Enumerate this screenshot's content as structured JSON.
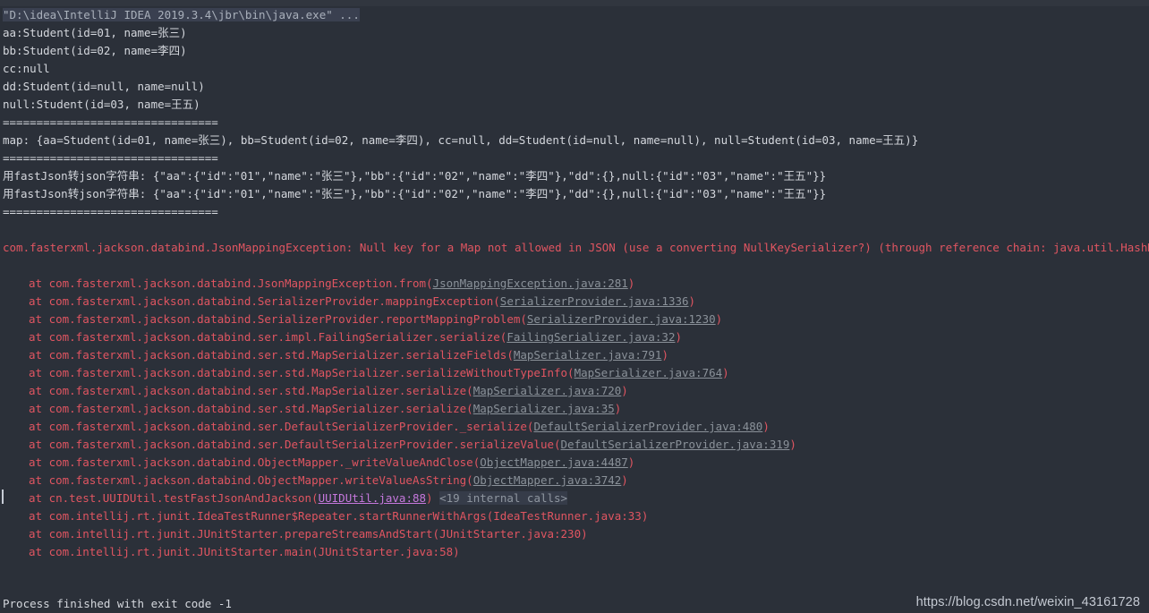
{
  "console": {
    "command_line": "\"D:\\idea\\IntelliJ IDEA 2019.3.4\\jbr\\bin\\java.exe\" ...",
    "output_lines": [
      "aa:Student(id=01, name=张三)",
      "bb:Student(id=02, name=李四)",
      "cc:null",
      "dd:Student(id=null, name=null)",
      "null:Student(id=03, name=王五)"
    ],
    "separator": "================================",
    "map_line": "map: {aa=Student(id=01, name=张三), bb=Student(id=02, name=李四), cc=null, dd=Student(id=null, name=null), null=Student(id=03, name=王五)}",
    "fastjson_line_1": "用fastJson转json字符串: {\"aa\":{\"id\":\"01\",\"name\":\"张三\"},\"bb\":{\"id\":\"02\",\"name\":\"李四\"},\"dd\":{},null:{\"id\":\"03\",\"name\":\"王五\"}}",
    "fastjson_line_2": "用fastJson转json字符串: {\"aa\":{\"id\":\"01\",\"name\":\"张三\"},\"bb\":{\"id\":\"02\",\"name\":\"李四\"},\"dd\":{},null:{\"id\":\"03\",\"name\":\"王五\"}}",
    "exception_header": "com.fasterxml.jackson.databind.JsonMappingException: Null key for a Map not allowed in JSON (use a converting NullKeySerializer?) (through reference chain: java.util.HashMap[\"null\"])",
    "stack_frames": [
      {
        "prefix": "at com.fasterxml.jackson.databind.JsonMappingException.from(",
        "link": "JsonMappingException.java:281",
        "link_style": "normal",
        "suffix": ")",
        "trailing": ""
      },
      {
        "prefix": "at com.fasterxml.jackson.databind.SerializerProvider.mappingException(",
        "link": "SerializerProvider.java:1336",
        "link_style": "normal",
        "suffix": ")",
        "trailing": ""
      },
      {
        "prefix": "at com.fasterxml.jackson.databind.SerializerProvider.reportMappingProblem(",
        "link": "SerializerProvider.java:1230",
        "link_style": "normal",
        "suffix": ")",
        "trailing": ""
      },
      {
        "prefix": "at com.fasterxml.jackson.databind.ser.impl.FailingSerializer.serialize(",
        "link": "FailingSerializer.java:32",
        "link_style": "normal",
        "suffix": ")",
        "trailing": ""
      },
      {
        "prefix": "at com.fasterxml.jackson.databind.ser.std.MapSerializer.serializeFields(",
        "link": "MapSerializer.java:791",
        "link_style": "normal",
        "suffix": ")",
        "trailing": ""
      },
      {
        "prefix": "at com.fasterxml.jackson.databind.ser.std.MapSerializer.serializeWithoutTypeInfo(",
        "link": "MapSerializer.java:764",
        "link_style": "normal",
        "suffix": ")",
        "trailing": ""
      },
      {
        "prefix": "at com.fasterxml.jackson.databind.ser.std.MapSerializer.serialize(",
        "link": "MapSerializer.java:720",
        "link_style": "normal",
        "suffix": ")",
        "trailing": ""
      },
      {
        "prefix": "at com.fasterxml.jackson.databind.ser.std.MapSerializer.serialize(",
        "link": "MapSerializer.java:35",
        "link_style": "normal",
        "suffix": ")",
        "trailing": ""
      },
      {
        "prefix": "at com.fasterxml.jackson.databind.ser.DefaultSerializerProvider._serialize(",
        "link": "DefaultSerializerProvider.java:480",
        "link_style": "normal",
        "suffix": ")",
        "trailing": ""
      },
      {
        "prefix": "at com.fasterxml.jackson.databind.ser.DefaultSerializerProvider.serializeValue(",
        "link": "DefaultSerializerProvider.java:319",
        "link_style": "normal",
        "suffix": ")",
        "trailing": ""
      },
      {
        "prefix": "at com.fasterxml.jackson.databind.ObjectMapper._writeValueAndClose(",
        "link": "ObjectMapper.java:4487",
        "link_style": "normal",
        "suffix": ")",
        "trailing": ""
      },
      {
        "prefix": "at com.fasterxml.jackson.databind.ObjectMapper.writeValueAsString(",
        "link": "ObjectMapper.java:3742",
        "link_style": "normal",
        "suffix": ")",
        "trailing": ""
      },
      {
        "prefix": "at cn.test.UUIDUtil.testFastJsonAndJackson(",
        "link": "UUIDUtil.java:88",
        "link_style": "visited",
        "suffix": ")",
        "trailing": "<19 internal calls>"
      },
      {
        "prefix": "at com.intellij.rt.junit.IdeaTestRunner$Repeater.startRunnerWithArgs(IdeaTestRunner.java:33)",
        "link": "",
        "link_style": "none",
        "suffix": "",
        "trailing": ""
      },
      {
        "prefix": "at com.intellij.rt.junit.JUnitStarter.prepareStreamsAndStart(JUnitStarter.java:230)",
        "link": "",
        "link_style": "none",
        "suffix": "",
        "trailing": ""
      },
      {
        "prefix": "at com.intellij.rt.junit.JUnitStarter.main(JUnitStarter.java:58)",
        "link": "",
        "link_style": "none",
        "suffix": "",
        "trailing": ""
      }
    ],
    "process_status": "Process finished with exit code -1",
    "watermark": "https://blog.csdn.net/weixin_43161728"
  },
  "colors": {
    "background": "#2b3039",
    "top_strip": "#31363f",
    "output_text": "#d4d7dd",
    "error_text": "#e05561",
    "link": "#8a9199",
    "link_visited": "#c678dd",
    "highlight_bg": "#3a4050",
    "internal_calls_bg": "#363c49"
  }
}
